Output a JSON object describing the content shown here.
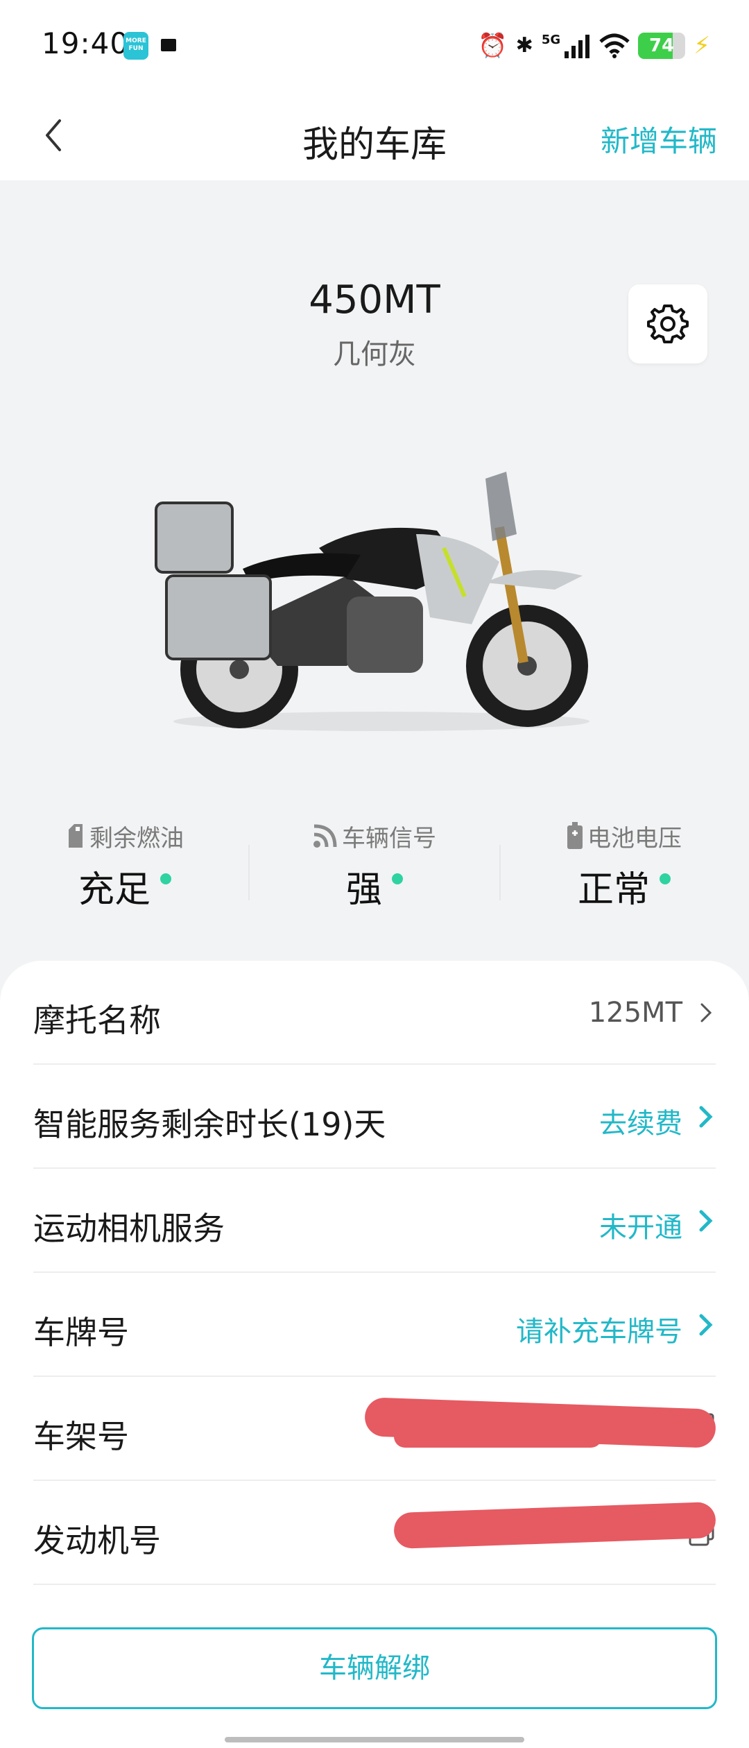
{
  "status_bar": {
    "time": "19:40",
    "app_icon_text": "MORE FUN",
    "network": "5G",
    "battery_level": 74,
    "battery_text": "74",
    "icons": [
      "alarm-icon",
      "bluetooth-icon",
      "signal-icon",
      "wifi-icon",
      "battery-icon",
      "charging-icon"
    ]
  },
  "nav": {
    "title": "我的车库",
    "add_label": "新增车辆"
  },
  "vehicle": {
    "model": "450MT",
    "color": "几何灰"
  },
  "stats": [
    {
      "label": "剩余燃油",
      "value": "充足",
      "icon": "fuel-icon"
    },
    {
      "label": "车辆信号",
      "value": "强",
      "icon": "signal-rss-icon"
    },
    {
      "label": "电池电压",
      "value": "正常",
      "icon": "battery-voltage-icon"
    }
  ],
  "rows": {
    "moto_name": {
      "label": "摩托名称",
      "value": "125MT"
    },
    "smart_service": {
      "label": "智能服务剩余时长(19)天",
      "value": "去续费"
    },
    "camera_service": {
      "label": "运动相机服务",
      "value": "未开通"
    },
    "plate": {
      "label": "车牌号",
      "value": "请补充车牌号"
    },
    "frame": {
      "label": "车架号"
    },
    "engine": {
      "label": "发动机号"
    }
  },
  "unbind_label": "车辆解绑",
  "colors": {
    "accent": "#22b8c8",
    "status_dot": "#2ed3a1",
    "redaction": "#e65a62"
  }
}
